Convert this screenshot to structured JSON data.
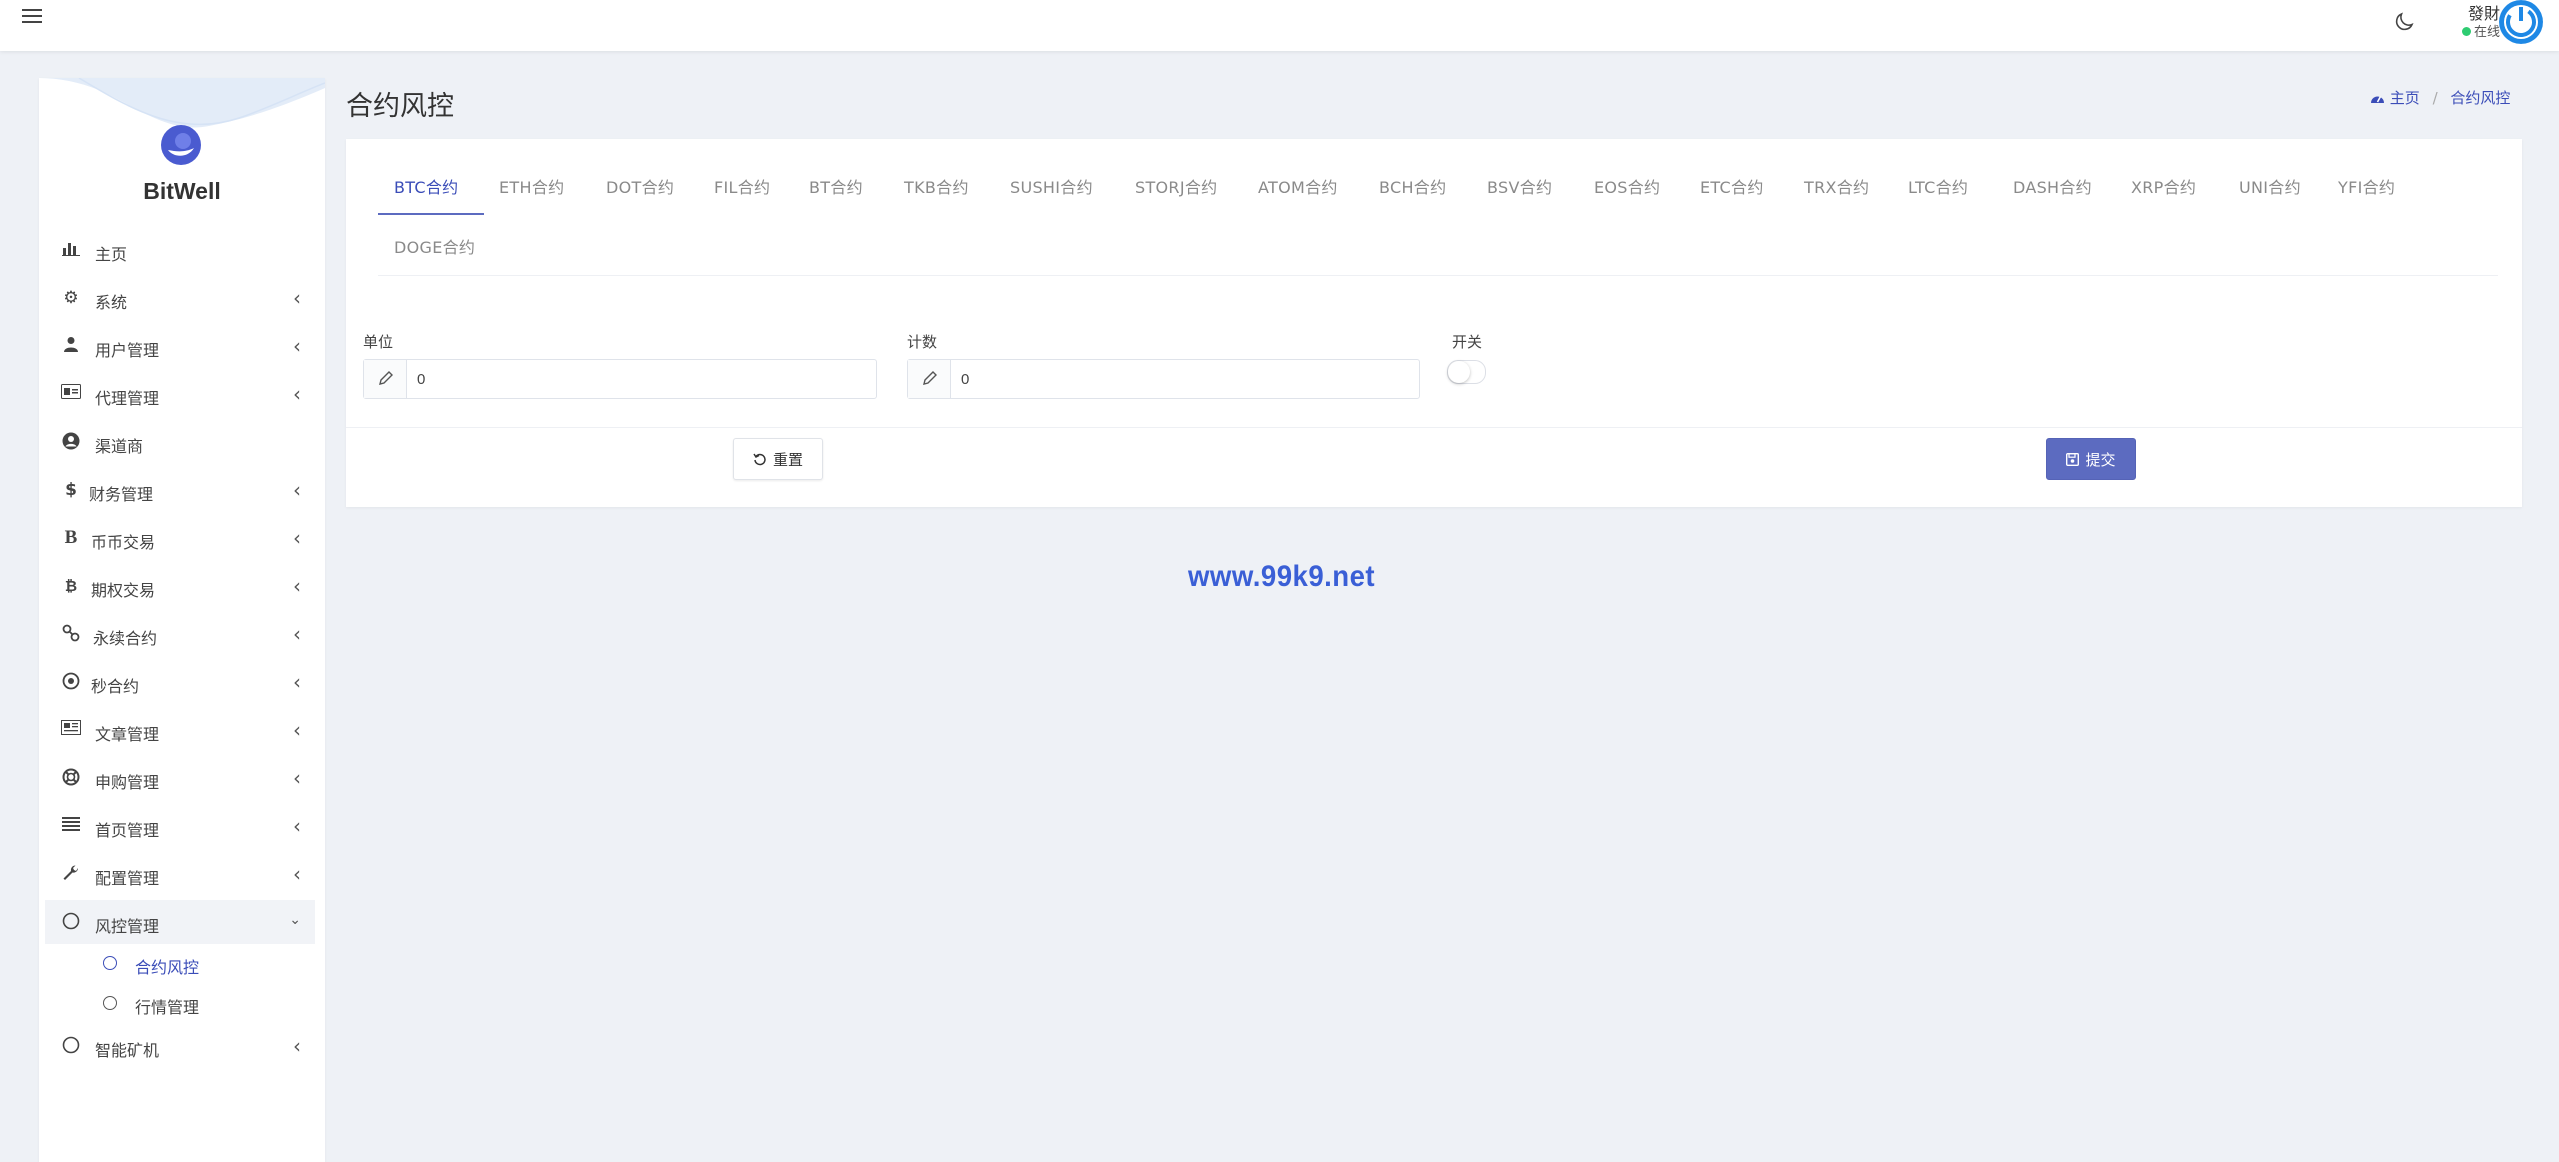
{
  "header": {
    "user_name": "發財",
    "user_status": "在线"
  },
  "brand": {
    "name": "BitWell"
  },
  "sidebar": {
    "items": [
      {
        "label": "主页",
        "icon": "bar-chart-icon",
        "has_arrow": false
      },
      {
        "label": "系统",
        "icon": "gear-icon",
        "has_arrow": true
      },
      {
        "label": "用户管理",
        "icon": "user-tie-icon",
        "has_arrow": true
      },
      {
        "label": "代理管理",
        "icon": "id-card-icon",
        "has_arrow": true
      },
      {
        "label": "渠道商",
        "icon": "user-circle-icon",
        "has_arrow": false
      },
      {
        "label": "财务管理",
        "icon": "dollar-icon",
        "has_arrow": true
      },
      {
        "label": "币币交易",
        "icon": "bold-b-icon",
        "has_arrow": true
      },
      {
        "label": "期权交易",
        "icon": "bitcoin-icon",
        "has_arrow": true
      },
      {
        "label": "永续合约",
        "icon": "link-icon",
        "has_arrow": true
      },
      {
        "label": "秒合约",
        "icon": "dot-circle-icon",
        "has_arrow": true
      },
      {
        "label": "文章管理",
        "icon": "newspaper-icon",
        "has_arrow": true
      },
      {
        "label": "申购管理",
        "icon": "life-ring-icon",
        "has_arrow": true
      },
      {
        "label": "首页管理",
        "icon": "list-icon",
        "has_arrow": true
      },
      {
        "label": "配置管理",
        "icon": "wrench-icon",
        "has_arrow": true
      },
      {
        "label": "风控管理",
        "icon": "circle-icon",
        "has_arrow": true
      },
      {
        "label": "智能矿机",
        "icon": "circle-icon",
        "has_arrow": true
      }
    ],
    "risk_sub_items": [
      {
        "label": "合约风控",
        "active": true
      },
      {
        "label": "行情管理",
        "active": false
      }
    ]
  },
  "page": {
    "title": "合约风控"
  },
  "breadcrumb": {
    "home": "主页",
    "current": "合约风控"
  },
  "tabs": [
    "BTC合约",
    "ETH合约",
    "DOT合约",
    "FIL合约",
    "BT合约",
    "TKB合约",
    "SUSHI合约",
    "STORJ合约",
    "ATOM合约",
    "BCH合约",
    "BSV合约",
    "EOS合约",
    "ETC合约",
    "TRX合约",
    "LTC合约",
    "DASH合约",
    "XRP合约",
    "UNI合约",
    "YFI合约",
    "DOGE合约"
  ],
  "active_tab": "BTC合约",
  "form": {
    "unit_label": "单位",
    "unit_value": "0",
    "count_label": "计数",
    "count_value": "0",
    "switch_label": "开关",
    "switch_on": false,
    "reset_label": "重置",
    "submit_label": "提交"
  },
  "watermark": "www.99k9.net",
  "colors": {
    "accent": "#5c6bc0",
    "link": "#3b4db8",
    "online": "#2ecc71",
    "avatar": "#1e88e5"
  }
}
